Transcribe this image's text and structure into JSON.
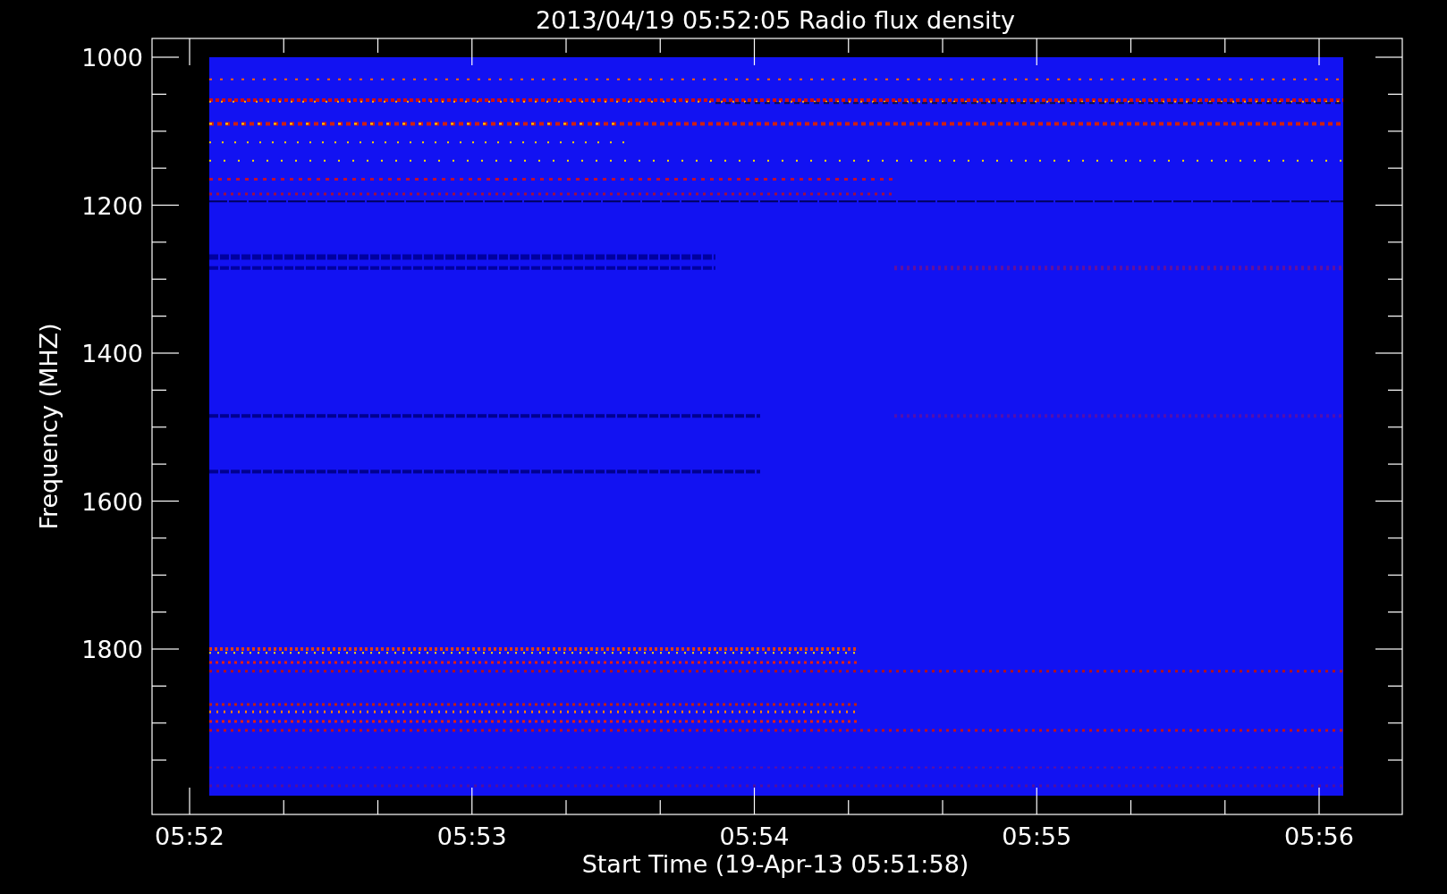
{
  "title": "2013/04/19 05:52:05 Radio flux density",
  "y_axis": {
    "label": "Frequency (MHZ)",
    "ticks": [
      "1000",
      "1200",
      "1400",
      "1600",
      "1800"
    ]
  },
  "x_axis": {
    "label": "Start Time (19-Apr-13 05:51:58)",
    "ticks": [
      "05:52",
      "05:53",
      "05:54",
      "05:55",
      "05:56"
    ]
  }
}
